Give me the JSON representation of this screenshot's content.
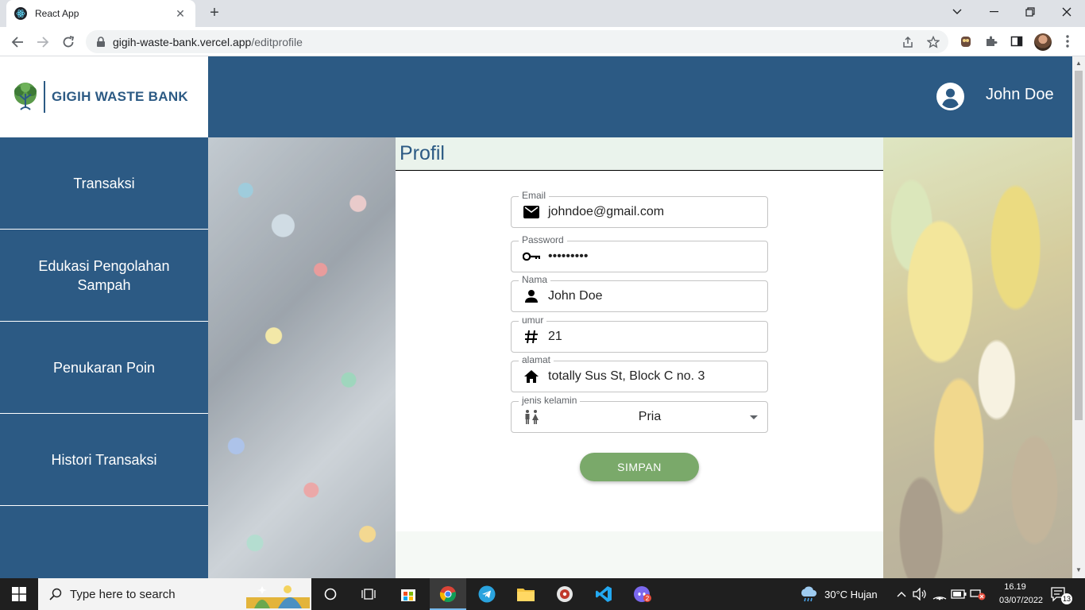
{
  "browser": {
    "tab_title": "React App",
    "url_domain": "gigih-waste-bank.vercel.app",
    "url_path": "/editprofile"
  },
  "app": {
    "brand": "GIGIH WASTE BANK",
    "user_name": "John Doe",
    "colors": {
      "primary": "#2c5a84",
      "button": "#7aa96a"
    }
  },
  "sidebar": {
    "items": [
      {
        "label": "Transaksi"
      },
      {
        "label": "Edukasi Pengolahan Sampah"
      },
      {
        "label": "Penukaran Poin"
      },
      {
        "label": "Histori Transaksi"
      }
    ]
  },
  "profile": {
    "title": "Profil",
    "fields": {
      "email": {
        "label": "Email",
        "value": "johndoe@gmail.com",
        "icon": "mail-icon"
      },
      "password": {
        "label": "Password",
        "value": "•••••••••",
        "icon": "key-icon"
      },
      "nama": {
        "label": "Nama",
        "value": "John Doe",
        "icon": "person-icon"
      },
      "umur": {
        "label": "umur",
        "value": "21",
        "icon": "hash-icon"
      },
      "alamat": {
        "label": "alamat",
        "value": "totally Sus St, Block C no. 3",
        "icon": "home-icon"
      },
      "jenis_kelamin": {
        "label": "jenis kelamin",
        "value": "Pria",
        "icon": "wc-icon"
      }
    },
    "save_label": "SIMPAN"
  },
  "taskbar": {
    "search_placeholder": "Type here to search",
    "weather": "30°C  Hujan",
    "time": "16.19",
    "date": "03/07/2022",
    "notifications": "13"
  }
}
